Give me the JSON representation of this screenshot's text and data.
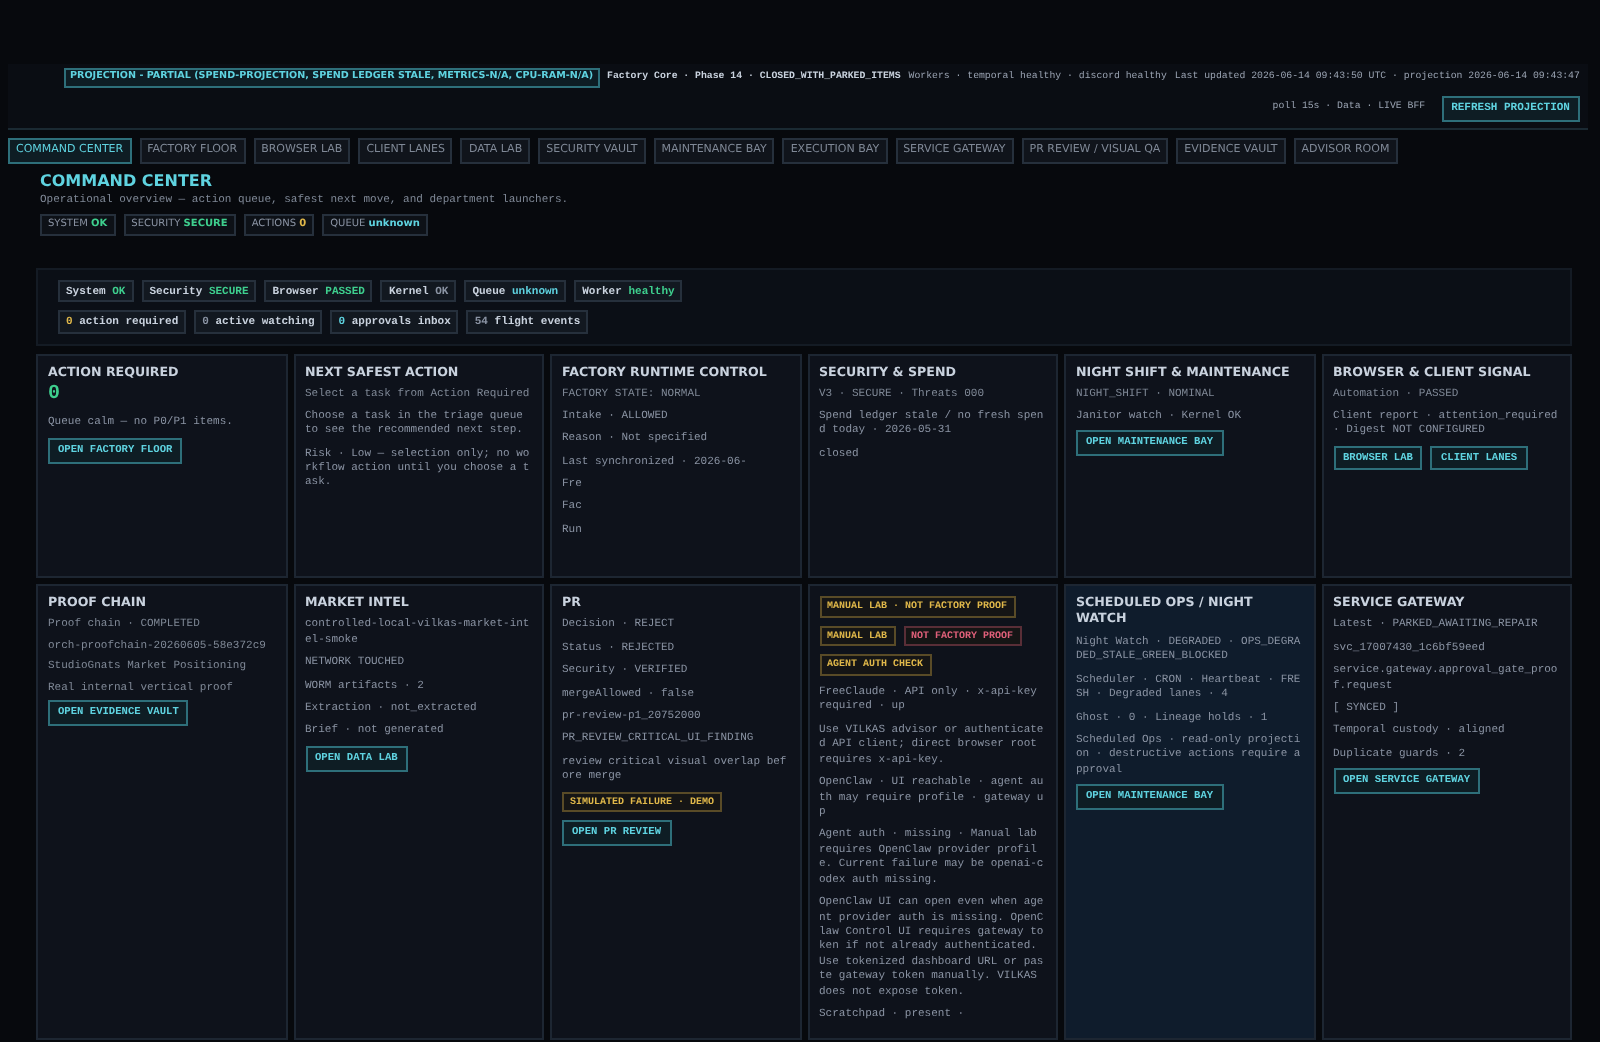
{
  "top_bar": {
    "projection": "PROJECTION - PARTIAL (SPEND-PROJECTION, SPEND LEDGER STALE, METRICS-N/A, CPU-RAM-N/A)",
    "phase": "Factory Core · Phase 14 · CLOSED_WITH_PARKED_ITEMS",
    "workers": "Workers · temporal healthy · discord healthy",
    "updated": "Last updated 2026-06-14 09:43:50 UTC · projection 2026-06-14 09:43:47",
    "poll": "poll 15s · Data · LIVE BFF",
    "refresh_button": "REFRESH PROJECTION"
  },
  "tabs": [
    {
      "label": "COMMAND CENTER",
      "selected": true
    },
    {
      "label": "FACTORY FLOOR",
      "selected": false
    },
    {
      "label": "BROWSER LAB",
      "selected": false
    },
    {
      "label": "CLIENT LANES",
      "selected": false
    },
    {
      "label": "DATA LAB",
      "selected": false
    },
    {
      "label": "SECURITY VAULT",
      "selected": false
    },
    {
      "label": "MAINTENANCE BAY",
      "selected": false
    },
    {
      "label": "EXECUTION BAY",
      "selected": false
    },
    {
      "label": "SERVICE GATEWAY",
      "selected": false
    },
    {
      "label": "PR REVIEW / VISUAL QA",
      "selected": false
    },
    {
      "label": "EVIDENCE VAULT",
      "selected": false
    },
    {
      "label": "ADVISOR ROOM",
      "selected": false
    }
  ],
  "page": {
    "title": "COMMAND CENTER",
    "subtitle": "Operational overview — action queue, safest next move, and department launchers.",
    "chips": [
      {
        "label": "SYSTEM",
        "value": "OK",
        "color": "#3ecf8e"
      },
      {
        "label": "SECURITY",
        "value": "SECURE",
        "color": "#3ecf8e"
      },
      {
        "label": "ACTIONS",
        "value": "0",
        "color": "#e0b84a"
      },
      {
        "label": "QUEUE",
        "value": "unknown",
        "color": "#5fd3e0"
      }
    ]
  },
  "status_chips": [
    {
      "label": "System",
      "value": "OK",
      "color": "#3ecf8e"
    },
    {
      "label": "Security",
      "value": "SECURE",
      "color": "#3ecf8e"
    },
    {
      "label": "Browser",
      "value": "PASSED",
      "color": "#3ecf8e"
    },
    {
      "label": "Kernel",
      "value": "OK",
      "color": "#8a93a3"
    },
    {
      "label": "Queue",
      "value": "unknown",
      "color": "#5fd3e0"
    },
    {
      "label": "Worker",
      "value": "healthy",
      "color": "#3ecf8e"
    }
  ],
  "counters": [
    {
      "value": "0",
      "label": "action required",
      "color": "#e0b84a"
    },
    {
      "value": "0",
      "label": "active watching",
      "color": "#8a93a3"
    },
    {
      "value": "0",
      "label": "approvals inbox",
      "color": "#5fd3e0"
    },
    {
      "value": "54",
      "label": "flight events",
      "color": "#8a93a3"
    }
  ],
  "cards": [
    {
      "title": "ACTION REQUIRED",
      "highlighted": false,
      "blocks": [
        {
          "kind": "big",
          "text": "0"
        },
        {
          "kind": "text",
          "text": "Queue calm — no P0/P1 items."
        },
        {
          "kind": "buttons",
          "labels": [
            "OPEN FACTORY FLOOR"
          ]
        }
      ]
    },
    {
      "title": "NEXT SAFEST ACTION",
      "highlighted": false,
      "blocks": [
        {
          "kind": "sub",
          "text": "Select a task from Action Required"
        },
        {
          "kind": "text",
          "text": "Choose a task in the triage queue to see the recommended next step."
        },
        {
          "kind": "text",
          "text": "Risk · Low — selection only; no workflow action until you choose a task."
        }
      ]
    },
    {
      "title": "FACTORY RUNTIME CONTROL",
      "highlighted": false,
      "blocks": [
        {
          "kind": "sub",
          "text": "FACTORY STATE: NORMAL"
        },
        {
          "kind": "text",
          "text": "Intake · ALLOWED"
        },
        {
          "kind": "text",
          "text": "Reason · Not specified"
        },
        {
          "kind": "text",
          "text": "Last synchronized · 2026-06-"
        },
        {
          "kind": "text",
          "text": "Fre"
        },
        {
          "kind": "text",
          "text": "Fac"
        },
        {
          "kind": "text",
          "text": "Run"
        }
      ]
    },
    {
      "title": "SECURITY & SPEND",
      "highlighted": false,
      "blocks": [
        {
          "kind": "sub",
          "text": "V3 · SECURE · Threats 000"
        },
        {
          "kind": "text",
          "text": "Spend ledger stale / no fresh spend today · 2026-05-31"
        },
        {
          "kind": "text",
          "text": "closed"
        }
      ]
    },
    {
      "title": "NIGHT SHIFT & MAINTENANCE",
      "highlighted": false,
      "blocks": [
        {
          "kind": "sub",
          "text": "NIGHT_SHIFT · NOMINAL"
        },
        {
          "kind": "text",
          "text": "Janitor watch · Kernel OK"
        },
        {
          "kind": "buttons",
          "labels": [
            "OPEN MAINTENANCE BAY"
          ]
        }
      ]
    },
    {
      "title": "BROWSER & CLIENT SIGNAL",
      "highlighted": false,
      "blocks": [
        {
          "kind": "sub",
          "text": "Automation · PASSED"
        },
        {
          "kind": "text",
          "text": "Client report · attention_required · Digest NOT CONFIGURED"
        },
        {
          "kind": "buttons",
          "labels": [
            "BROWSER LAB",
            "CLIENT LANES"
          ]
        }
      ]
    },
    {
      "title": "PROOF CHAIN",
      "highlighted": false,
      "blocks": [
        {
          "kind": "sub",
          "text": "Proof chain · COMPLETED"
        },
        {
          "kind": "sub",
          "text": "orch-proofchain-20260605-58e372c9"
        },
        {
          "kind": "sub",
          "text": "StudioGnats Market Positioning"
        },
        {
          "kind": "sub",
          "text": "Real internal vertical proof"
        },
        {
          "kind": "buttons",
          "labels": [
            "OPEN EVIDENCE VAULT"
          ]
        }
      ]
    },
    {
      "title": "MARKET INTEL",
      "highlighted": false,
      "blocks": [
        {
          "kind": "text",
          "text": "controlled-local-vilkas-market-intel-smoke"
        },
        {
          "kind": "text",
          "text": "NETWORK TOUCHED"
        },
        {
          "kind": "text",
          "text": "WORM artifacts · 2"
        },
        {
          "kind": "text",
          "text": "Extraction · not_extracted"
        },
        {
          "kind": "text",
          "text": "Brief · not generated"
        },
        {
          "kind": "buttons",
          "labels": [
            "OPEN DATA LAB"
          ]
        }
      ]
    },
    {
      "title": "PR",
      "highlighted": false,
      "blocks": [
        {
          "kind": "text",
          "text": "Decision · REJECT"
        },
        {
          "kind": "text",
          "text": "Status · REJECTED"
        },
        {
          "kind": "text",
          "text": "Security · VERIFIED"
        },
        {
          "kind": "text",
          "text": "mergeAllowed · false"
        },
        {
          "kind": "text",
          "text": "pr-review-p1_20752000"
        },
        {
          "kind": "text",
          "text": "PR_REVIEW_CRITICAL_UI_FINDING"
        },
        {
          "kind": "text",
          "text": "review critical visual overlap before merge"
        },
        {
          "kind": "badges",
          "items": [
            {
              "text": "SIMULATED FAILURE · DEMO",
              "color": "#e0b84a"
            }
          ]
        },
        {
          "kind": "buttons",
          "labels": [
            "OPEN PR REVIEW"
          ]
        }
      ]
    },
    {
      "highlighted": false,
      "blocks": [
        {
          "kind": "badges",
          "items": [
            {
              "text": "MANUAL LAB · NOT FACTORY PROOF",
              "color": "#e0b84a"
            }
          ]
        },
        {
          "kind": "badges",
          "items": [
            {
              "text": "MANUAL LAB",
              "color": "#e0b84a"
            },
            {
              "text": "NOT FACTORY PROOF",
              "color": "#e0607a"
            }
          ]
        },
        {
          "kind": "badges",
          "items": [
            {
              "text": "AGENT AUTH CHECK",
              "color": "#e0b84a"
            }
          ]
        },
        {
          "kind": "text",
          "text": "FreeClaude · API only · x-api-key required · up"
        },
        {
          "kind": "text",
          "text": "Use VILKAS advisor or authenticated API client; direct browser root requires x-api-key."
        },
        {
          "kind": "text",
          "text": "OpenClaw · UI reachable · agent auth may require profile · gateway up"
        },
        {
          "kind": "text",
          "text": "Agent auth · missing · Manual lab requires OpenClaw provider profile. Current failure may be openai-codex auth missing."
        },
        {
          "kind": "text",
          "text": "OpenClaw UI can open even when agent provider auth is missing. OpenClaw Control UI requires gateway token if not already authenticated. Use tokenized dashboard URL or paste gateway token manually. VILKAS does not expose token."
        },
        {
          "kind": "text",
          "text": "Scratchpad · present ·"
        }
      ]
    },
    {
      "title": "SCHEDULED OPS / NIGHT WATCH",
      "highlighted": true,
      "blocks": [
        {
          "kind": "text",
          "text": "Night Watch · DEGRADED · OPS_DEGRADED_STALE_GREEN_BLOCKED"
        },
        {
          "kind": "text",
          "text": "Scheduler · CRON · Heartbeat · FRESH · Degraded lanes · 4"
        },
        {
          "kind": "text",
          "text": "Ghost · 0 · Lineage holds · 1"
        },
        {
          "kind": "text",
          "text": "Scheduled Ops · read-only projection · destructive actions require approval"
        },
        {
          "kind": "buttons",
          "labels": [
            "OPEN MAINTENANCE BAY"
          ]
        }
      ]
    },
    {
      "title": "SERVICE GATEWAY",
      "highlighted": false,
      "blocks": [
        {
          "kind": "text",
          "text": "Latest · PARKED_AWAITING_REPAIR"
        },
        {
          "kind": "text",
          "text": "svc_17007430_1c6bf59eed"
        },
        {
          "kind": "text",
          "text": "service.gateway.approval_gate_proof.request"
        },
        {
          "kind": "text",
          "text": "[ SYNCED ]"
        },
        {
          "kind": "text",
          "text": "Temporal custody · aligned"
        },
        {
          "kind": "text",
          "text": "Duplicate guards · 2"
        },
        {
          "kind": "buttons",
          "labels": [
            "OPEN SERVICE GATEWAY"
          ]
        }
      ]
    }
  ]
}
